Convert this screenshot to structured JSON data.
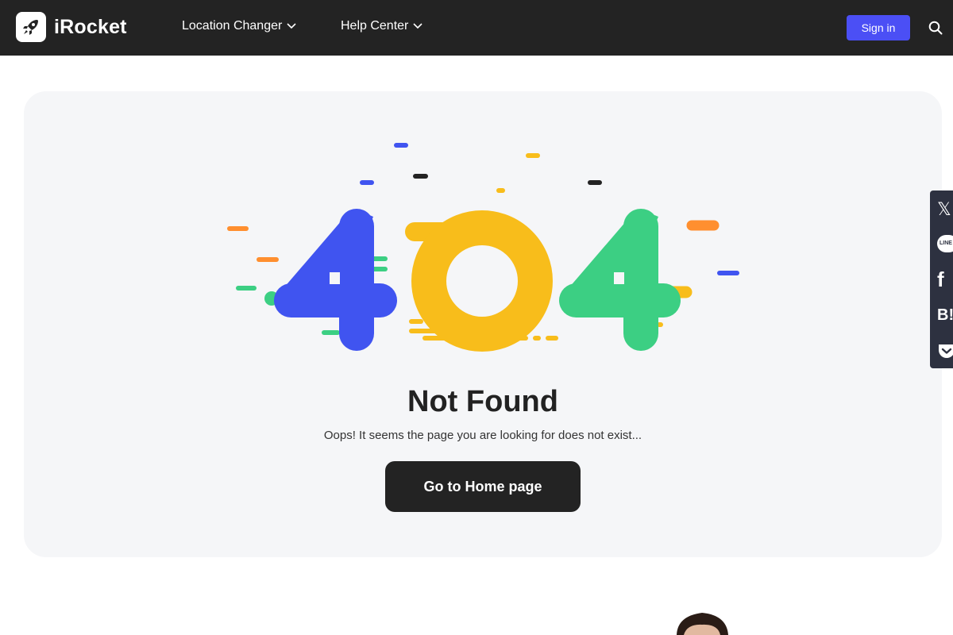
{
  "header": {
    "brand": "iRocket",
    "logo_icon": "rocket-icon",
    "nav": [
      {
        "label": "Location Changer",
        "icon": "chevron-down-icon"
      },
      {
        "label": "Help Center",
        "icon": "chevron-down-icon"
      }
    ],
    "signin_label": "Sign in",
    "search_icon": "search-icon",
    "background": "#232323",
    "signin_color": "#4b4ff5"
  },
  "error": {
    "code_digits": [
      "4",
      "0",
      "4"
    ],
    "digit_colors": [
      "#4054f0",
      "#f8bd1b",
      "#3ccf83"
    ],
    "title": "Not Found",
    "message": "Oops! It seems the page you are looking for does not exist...",
    "button_label": "Go to Home page"
  },
  "share": [
    {
      "icon": "x-twitter-icon",
      "text": "𝕏"
    },
    {
      "icon": "line-icon",
      "text": "LINE"
    },
    {
      "icon": "facebook-icon",
      "text": "f"
    },
    {
      "icon": "blogger-icon",
      "text": "B!"
    },
    {
      "icon": "pocket-icon",
      "text": ""
    }
  ]
}
